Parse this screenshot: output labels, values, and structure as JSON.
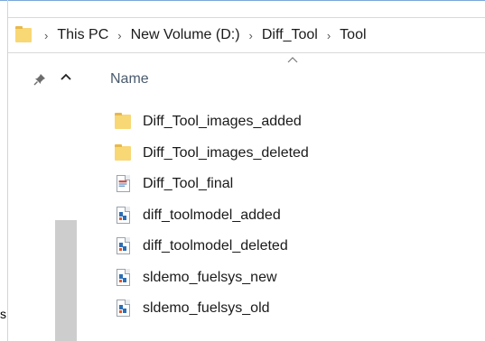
{
  "breadcrumb": {
    "items": [
      "This PC",
      "New Volume (D:)",
      "Diff_Tool",
      "Tool"
    ]
  },
  "left_stub": "s",
  "columns": {
    "name_label": "Name"
  },
  "files": [
    {
      "name": "Diff_Tool_images_added",
      "icon": "folder-icon"
    },
    {
      "name": "Diff_Tool_images_deleted",
      "icon": "folder-icon"
    },
    {
      "name": "Diff_Tool_final",
      "icon": "report-file-icon"
    },
    {
      "name": "diff_toolmodel_added",
      "icon": "model-file-icon"
    },
    {
      "name": "diff_toolmodel_deleted",
      "icon": "model-file-icon"
    },
    {
      "name": "sldemo_fuelsys_new",
      "icon": "model-file-icon"
    },
    {
      "name": "sldemo_fuelsys_old",
      "icon": "model-file-icon"
    }
  ],
  "colors": {
    "folder": "#f8d775",
    "folder_tab": "#e7b94b",
    "header_text": "#4a5b6e",
    "scrollbar": "#cdcdcd"
  }
}
